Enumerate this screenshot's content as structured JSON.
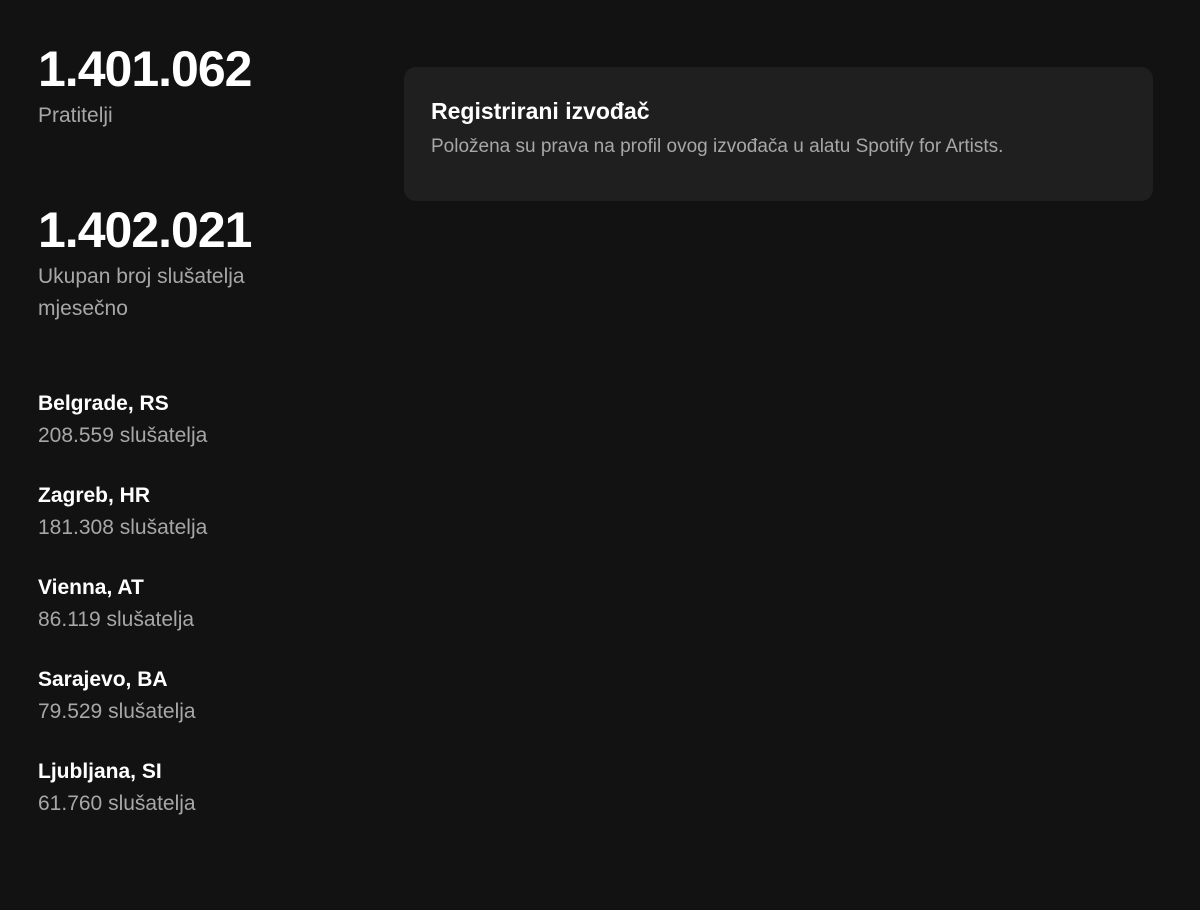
{
  "stats": {
    "followers": {
      "value": "1.401.062",
      "label": "Pratitelji"
    },
    "monthly_listeners": {
      "value": "1.402.021",
      "label": "Ukupan broj slušatelja mjesečno"
    }
  },
  "top_cities": [
    {
      "city": "Belgrade, RS",
      "listeners": "208.559 slušatelja"
    },
    {
      "city": "Zagreb, HR",
      "listeners": "181.308 slušatelja"
    },
    {
      "city": "Vienna, AT",
      "listeners": "86.119 slušatelja"
    },
    {
      "city": "Sarajevo, BA",
      "listeners": "79.529 slušatelja"
    },
    {
      "city": "Ljubljana, SI",
      "listeners": "61.760 slušatelja"
    }
  ],
  "verified_card": {
    "title": "Registrirani izvođač",
    "description": "Položena su prava na profil ovog izvođača u alatu Spotify for Artists."
  },
  "colors": {
    "background": "#121212",
    "card_background": "#1f1f1f",
    "text_primary": "#ffffff",
    "text_secondary": "#a7a7a7"
  }
}
